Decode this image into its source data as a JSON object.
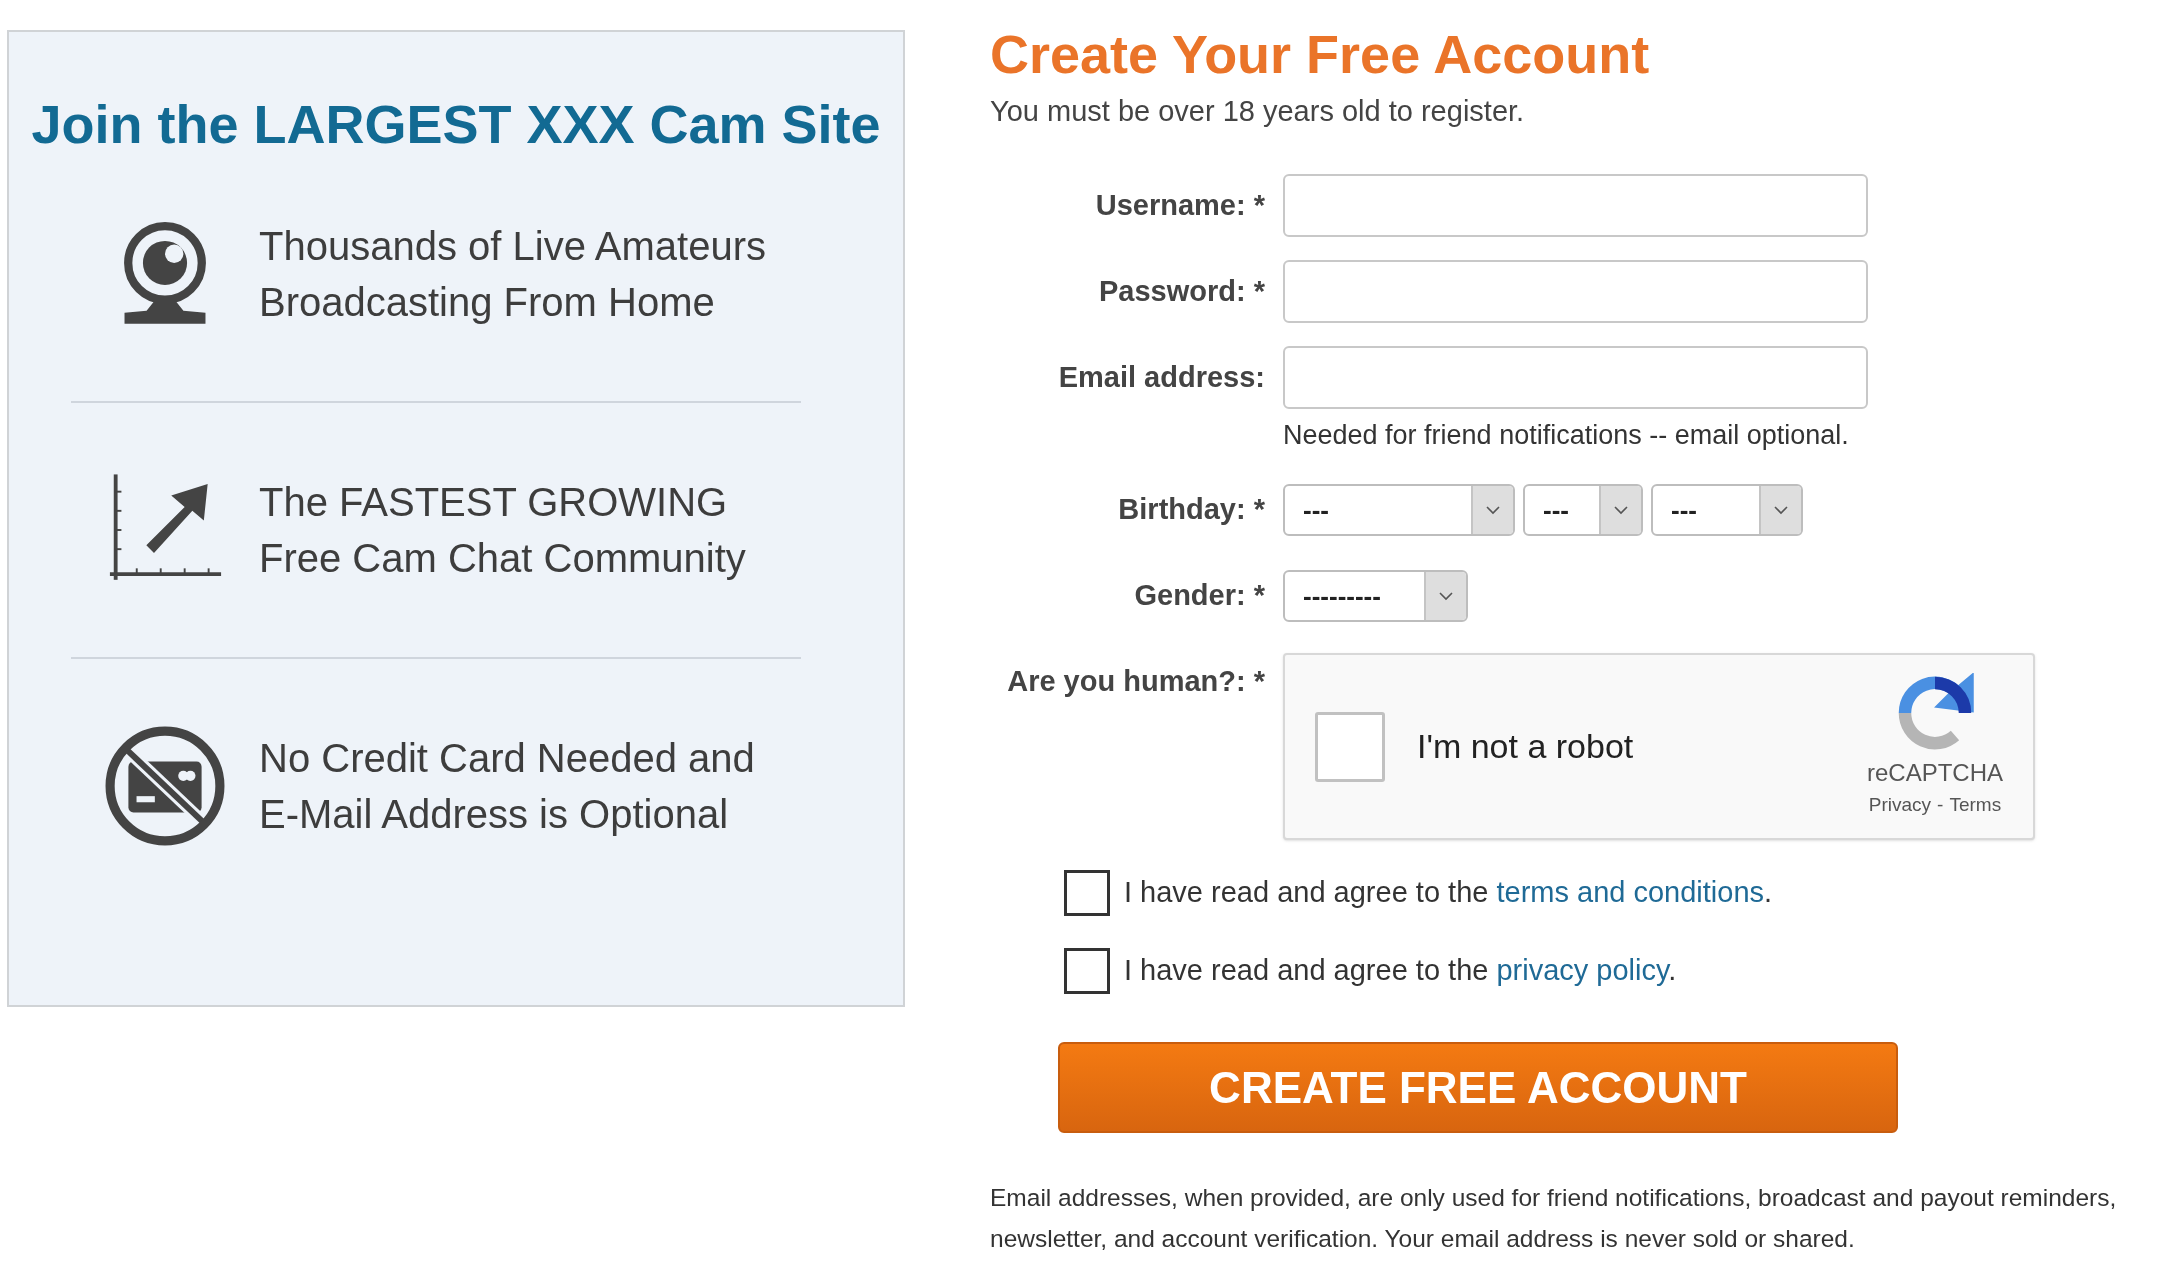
{
  "sidebar": {
    "title": "Join the LARGEST XXX Cam Site",
    "features": [
      {
        "kind": "webcam",
        "lines": [
          "Thousands of Live Amateurs",
          "Broadcasting From Home"
        ]
      },
      {
        "kind": "growth",
        "lines": [
          "The FASTEST GROWING",
          "Free Cam Chat Community"
        ]
      },
      {
        "kind": "no-card",
        "lines": [
          "No Credit Card Needed and",
          "E-Mail Address is Optional"
        ]
      }
    ]
  },
  "form": {
    "title": "Create Your Free Account",
    "subtitle": "You must be over 18 years old to register.",
    "fields": [
      {
        "kind": "text",
        "label": "Username: *"
      },
      {
        "kind": "password",
        "label": "Password: *"
      },
      {
        "kind": "email",
        "label": "Email address:",
        "hint": "Needed for friend notifications -- email optional."
      },
      {
        "kind": "selects",
        "label": "Birthday: *",
        "selects": [
          "---",
          "---",
          "---"
        ]
      },
      {
        "kind": "selects",
        "label": "Gender: *",
        "selects": [
          "---------"
        ]
      },
      {
        "kind": "captcha",
        "label": "Are you human?: *",
        "captcha": {
          "checked": false,
          "text": "I'm not a robot",
          "brand": "reCAPTCHA",
          "privacy": "Privacy",
          "separator": "-",
          "terms": "Terms"
        }
      }
    ],
    "agreements": [
      {
        "checked": false,
        "before": "I have read and agree to the",
        "link": "terms and conditions",
        "after": "."
      },
      {
        "checked": false,
        "before": "I have read and agree to the",
        "link": "privacy policy",
        "after": "."
      }
    ],
    "submit": "CREATE FREE ACCOUNT",
    "footnote": "Email addresses, when provided, are only used for friend notifications, broadcast and payout reminders, newsletter, and account verification. Your email address is never sold or shared."
  }
}
